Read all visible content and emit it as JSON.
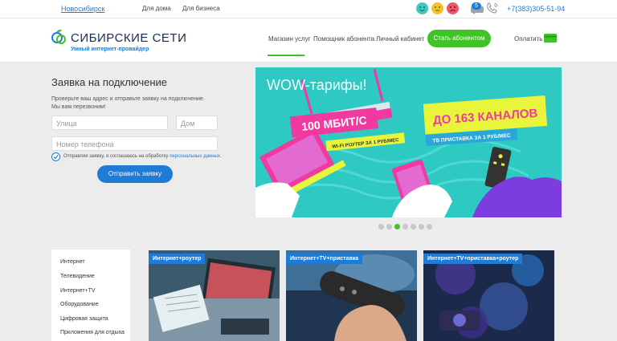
{
  "topbar": {
    "city": "Новосибирск",
    "links": [
      "Для дома",
      "Для бизнеса"
    ],
    "chat_count": "5",
    "phone": "+7(383)305-51-94"
  },
  "header": {
    "logo_title": "СИБИРСКИЕ СЕТИ",
    "logo_subtitle": "Умный интернет-провайдер",
    "nav": [
      "Магазин услуг",
      "Помощник абонента",
      "Личный кабинет"
    ],
    "cta": "Стать абонентом",
    "pay": "Оплатить"
  },
  "form": {
    "title": "Заявка на подключение",
    "description": "Проверьте ваш адрес и отправьте заявку на подключение. Мы вам перезвоним!",
    "street_placeholder": "Улица",
    "house_placeholder": "Дом",
    "phone_placeholder": "Номер телефона",
    "agree_text": "Отправляя заявку, я соглашаюсь на обработку ",
    "agree_link": "персональных данных",
    "agree_end": ".",
    "submit": "Отправить заявку"
  },
  "banner": {
    "title": "WOW-тарифы!",
    "speed": "100 МБИТ/С",
    "router": "WI-FI РОУТЕР ЗА 1 РУБ/МЕС",
    "channels": "ДО 163 КАНАЛОВ",
    "tv": "ТВ ПРИСТАВКА ЗА 1 РУБ/МЕС",
    "slide_count": 7,
    "active_slide": 3
  },
  "sidemenu": [
    "Интернет",
    "Телевидение",
    "Интернет+TV",
    "Оборудование",
    "Цифровая защита",
    "Приложения для отдыха"
  ],
  "cards": [
    "Интернет+роутер",
    "Интернет+TV+приставка",
    "Интернет+TV+приставка+роутер"
  ],
  "colors": {
    "brand_blue": "#1e7bd6",
    "brand_green": "#3fc326",
    "banner_bg": "#2ec9c2",
    "banner_pink": "#f03aa0",
    "banner_yellow": "#e9f53a"
  }
}
